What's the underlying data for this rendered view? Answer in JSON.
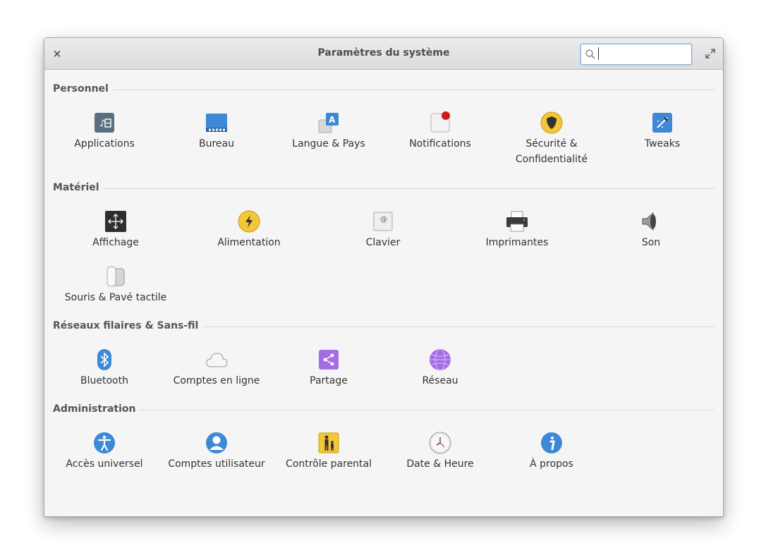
{
  "window": {
    "title": "Paramètres du système",
    "close_glyph": "×",
    "search": {
      "value": "",
      "placeholder": ""
    }
  },
  "sections": {
    "personnel": {
      "title": "Personnel",
      "items": [
        {
          "label": "Applications",
          "icon": "applications-icon"
        },
        {
          "label": "Bureau",
          "icon": "desktop-icon"
        },
        {
          "label": "Langue & Pays",
          "icon": "language-icon"
        },
        {
          "label": "Notifications",
          "icon": "notifications-icon"
        },
        {
          "label": "Sécurité & Confidentialité",
          "icon": "security-shield-icon"
        },
        {
          "label": "Tweaks",
          "icon": "tweaks-wand-icon"
        }
      ]
    },
    "materiel": {
      "title": "Matériel",
      "items": [
        {
          "label": "Affichage",
          "icon": "display-icon"
        },
        {
          "label": "Alimentation",
          "icon": "power-icon"
        },
        {
          "label": "Clavier",
          "icon": "keyboard-icon"
        },
        {
          "label": "Imprimantes",
          "icon": "printer-icon"
        },
        {
          "label": "Son",
          "icon": "speaker-icon"
        },
        {
          "label": "Souris & Pavé tactile",
          "icon": "mouse-icon"
        }
      ]
    },
    "reseaux": {
      "title": "Réseaux filaires & Sans-fil",
      "items": [
        {
          "label": "Bluetooth",
          "icon": "bluetooth-icon"
        },
        {
          "label": "Comptes en ligne",
          "icon": "cloud-icon"
        },
        {
          "label": "Partage",
          "icon": "share-icon"
        },
        {
          "label": "Réseau",
          "icon": "network-globe-icon"
        }
      ]
    },
    "administration": {
      "title": "Administration",
      "items": [
        {
          "label": "Accès universel",
          "icon": "accessibility-icon"
        },
        {
          "label": "Comptes utilisateur",
          "icon": "user-accounts-icon"
        },
        {
          "label": "Contrôle parental",
          "icon": "parental-control-icon"
        },
        {
          "label": "Date & Heure",
          "icon": "clock-icon"
        },
        {
          "label": "À propos",
          "icon": "about-info-icon"
        }
      ]
    }
  }
}
